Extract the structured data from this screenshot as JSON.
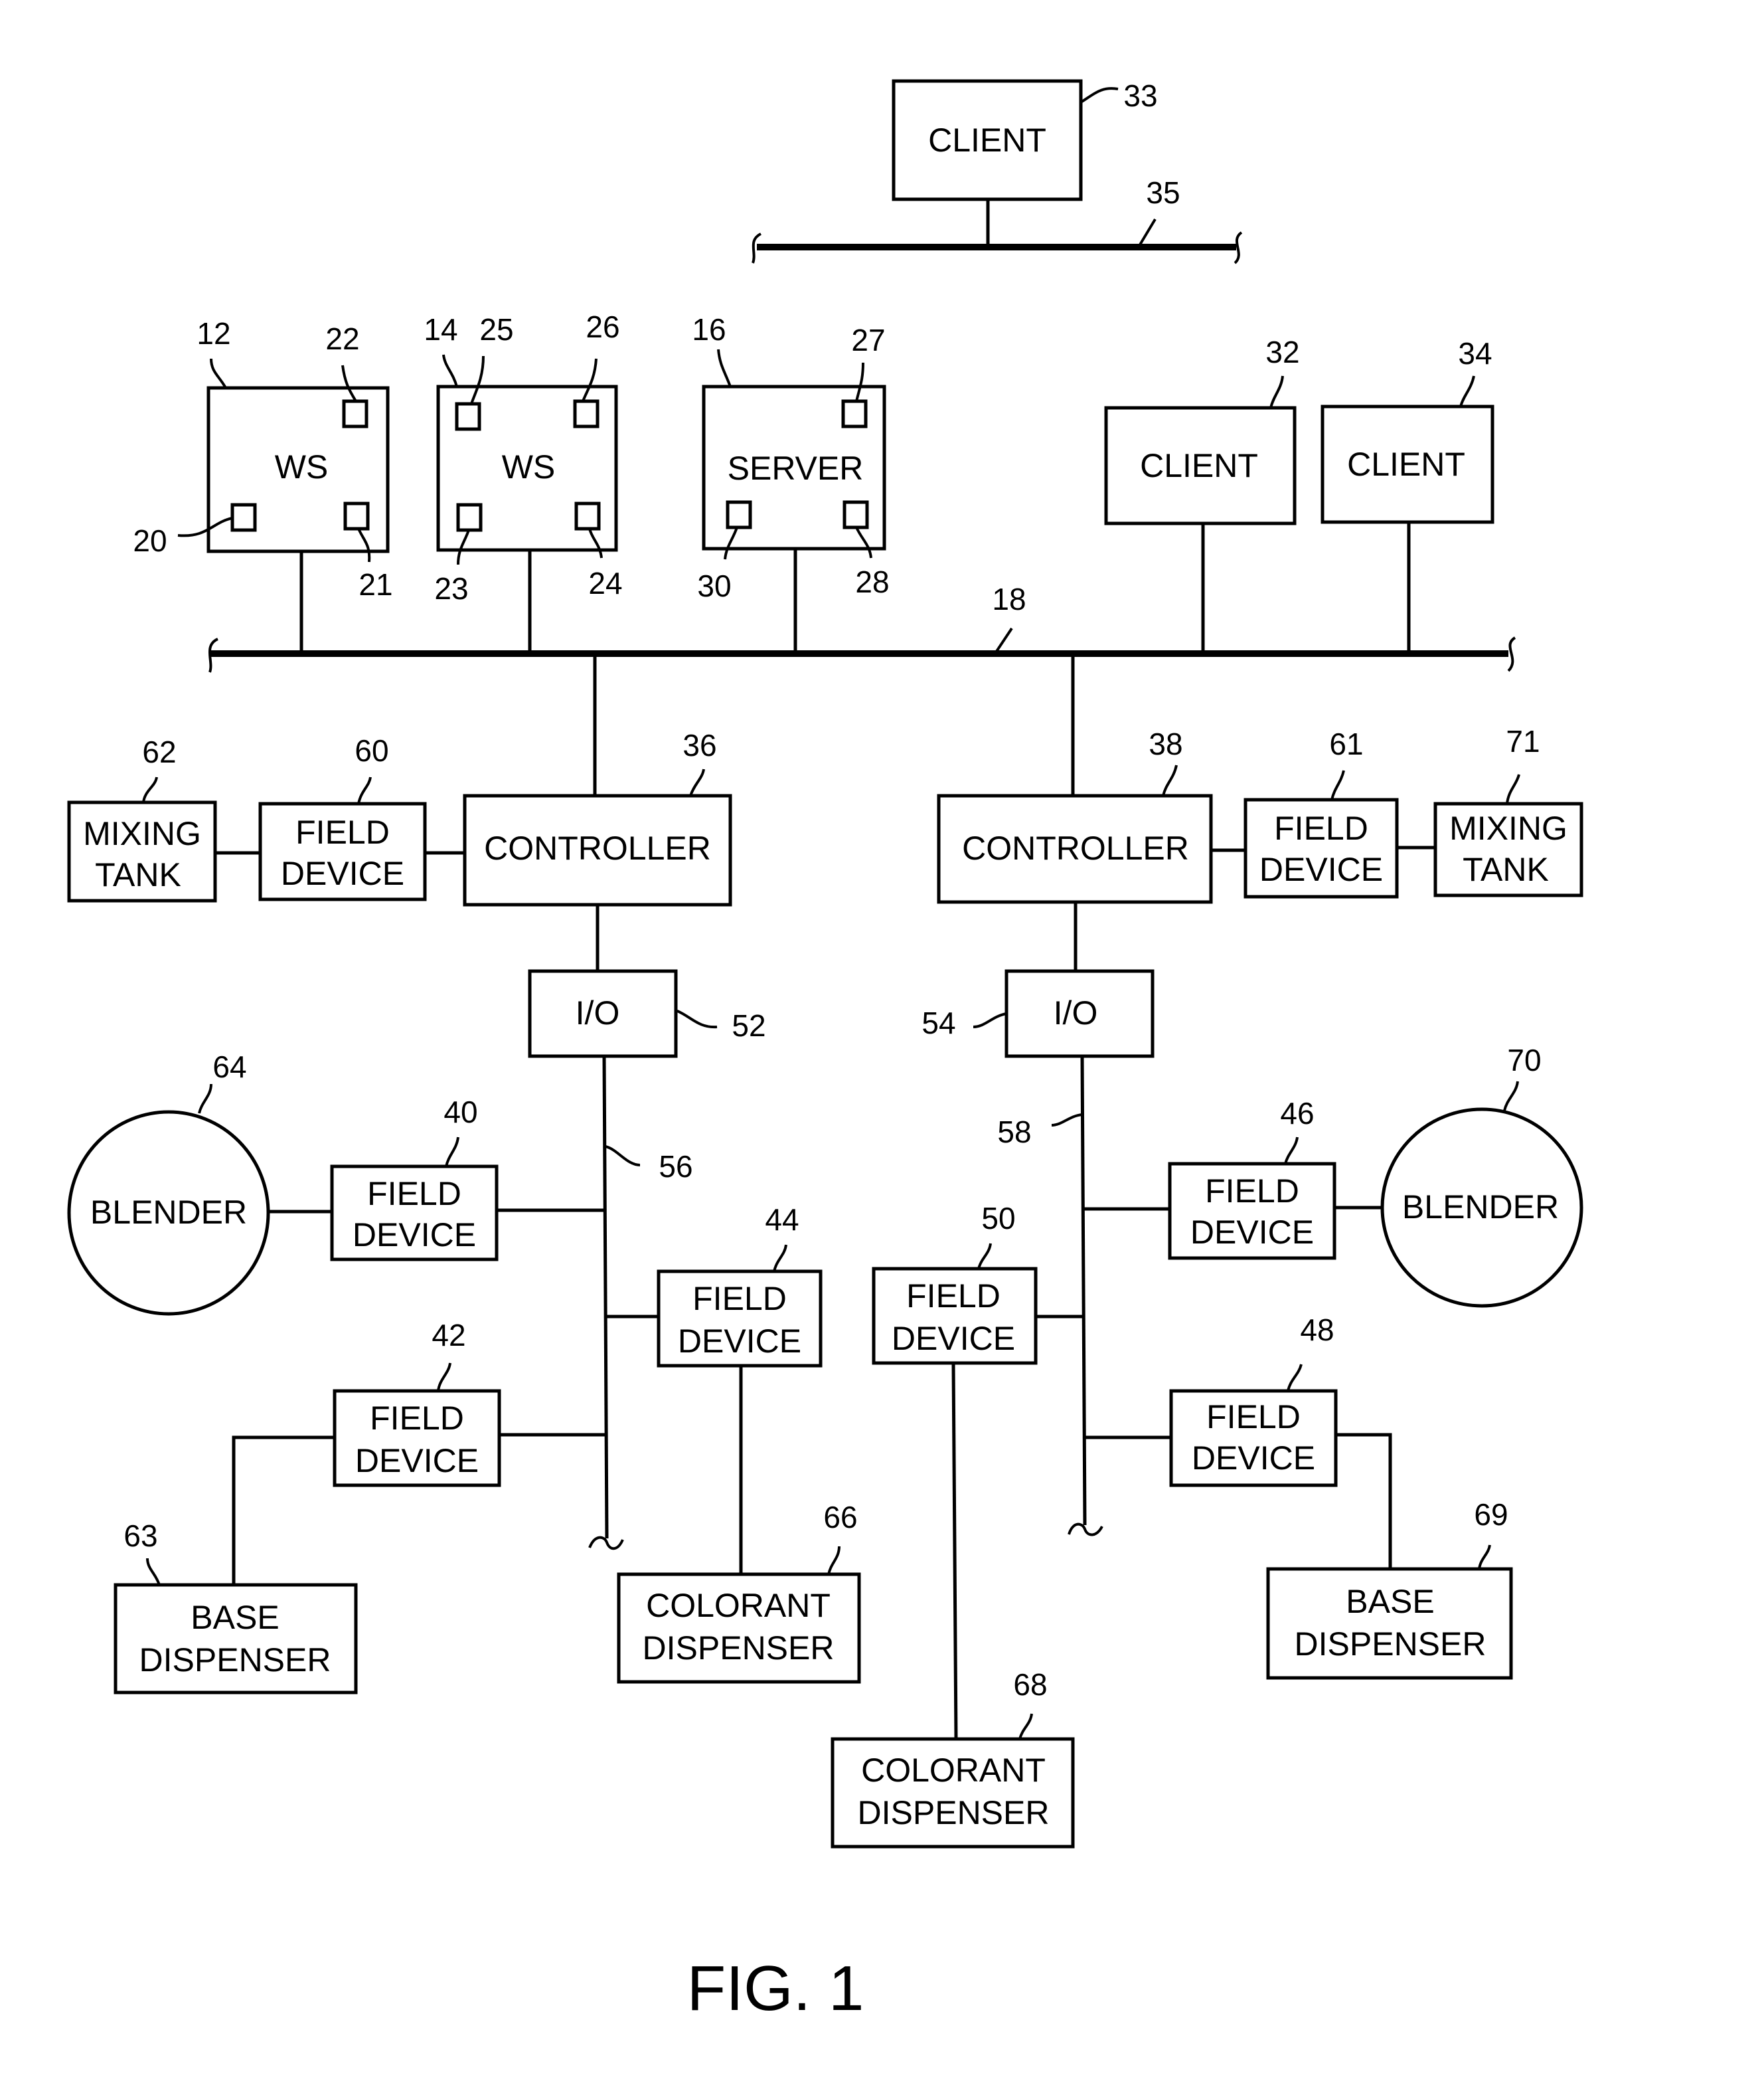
{
  "figure": {
    "caption": "FIG. 1",
    "top_network": {
      "client": {
        "label": "CLIENT",
        "ref": "33"
      },
      "bus_ref": "35"
    },
    "plant_network": {
      "bus_ref": "18",
      "workstations": [
        {
          "label": "WS",
          "ref": "12",
          "ports": [
            "22",
            "20",
            "21"
          ]
        },
        {
          "label": "WS",
          "ref": "14",
          "ports": [
            "25",
            "26",
            "23",
            "24"
          ]
        }
      ],
      "server": {
        "label": "SERVER",
        "ref": "16",
        "ports": [
          "27",
          "30",
          "28"
        ]
      },
      "clients": [
        {
          "label": "CLIENT",
          "ref": "32"
        },
        {
          "label": "CLIENT",
          "ref": "34"
        }
      ]
    },
    "left_branch": {
      "controller": {
        "label": "CONTROLLER",
        "ref": "36"
      },
      "field_device_tank": {
        "label_line1": "FIELD",
        "label_line2": "DEVICE",
        "ref": "60"
      },
      "mixing_tank": {
        "label_line1": "MIXING",
        "label_line2": "TANK",
        "ref": "62"
      },
      "io": {
        "label": "I/O",
        "ref": "52"
      },
      "io_bus_ref": "56",
      "blender": {
        "label": "BLENDER",
        "ref": "64"
      },
      "field_device_blender": {
        "label_line1": "FIELD",
        "label_line2": "DEVICE",
        "ref": "40"
      },
      "field_device_colorant": {
        "label_line1": "FIELD",
        "label_line2": "DEVICE",
        "ref": "44"
      },
      "field_device_base": {
        "label_line1": "FIELD",
        "label_line2": "DEVICE",
        "ref": "42"
      },
      "base_dispenser": {
        "label_line1": "BASE",
        "label_line2": "DISPENSER",
        "ref": "63"
      },
      "colorant_dispenser": {
        "label_line1": "COLORANT",
        "label_line2": "DISPENSER",
        "ref": "66"
      }
    },
    "right_branch": {
      "controller": {
        "label": "CONTROLLER",
        "ref": "38"
      },
      "field_device_tank": {
        "label_line1": "FIELD",
        "label_line2": "DEVICE",
        "ref": "61"
      },
      "mixing_tank": {
        "label_line1": "MIXING",
        "label_line2": "TANK",
        "ref": "71"
      },
      "io": {
        "label": "I/O",
        "ref": "54"
      },
      "io_bus_ref": "58",
      "blender": {
        "label": "BLENDER",
        "ref": "70"
      },
      "field_device_blender": {
        "label_line1": "FIELD",
        "label_line2": "DEVICE",
        "ref": "46"
      },
      "field_device_colorant": {
        "label_line1": "FIELD",
        "label_line2": "DEVICE",
        "ref": "50"
      },
      "field_device_base": {
        "label_line1": "FIELD",
        "label_line2": "DEVICE",
        "ref": "48"
      },
      "base_dispenser": {
        "label_line1": "BASE",
        "label_line2": "DISPENSER",
        "ref": "69"
      },
      "colorant_dispenser": {
        "label_line1": "COLORANT",
        "label_line2": "DISPENSER",
        "ref": "68"
      }
    }
  }
}
